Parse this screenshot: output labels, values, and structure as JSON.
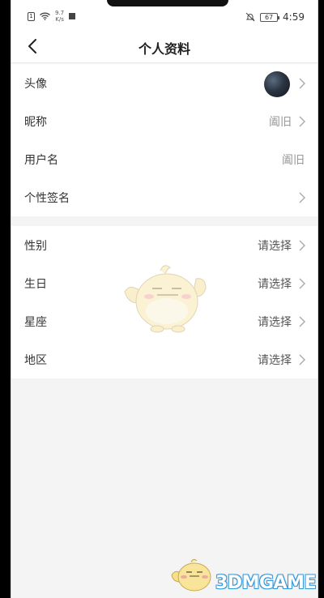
{
  "status_bar": {
    "sim_label": "1",
    "net_speed_value": "9.7",
    "net_speed_unit": "K/s",
    "battery": "67",
    "time": "4:59"
  },
  "nav": {
    "back_icon": "chevron-left-icon",
    "title": "个人资料"
  },
  "profile_section": [
    {
      "label": "头像",
      "value": ""
    },
    {
      "label": "昵称",
      "value": "阖旧"
    },
    {
      "label": "用户名",
      "value": "阖旧"
    },
    {
      "label": "个性签名",
      "value": ""
    }
  ],
  "details_section": [
    {
      "label": "性别",
      "value": "请选择"
    },
    {
      "label": "生日",
      "value": "请选择"
    },
    {
      "label": "星座",
      "value": "请选择"
    },
    {
      "label": "地区",
      "value": "请选择"
    }
  ],
  "watermark": {
    "text": "3DMGAME"
  }
}
